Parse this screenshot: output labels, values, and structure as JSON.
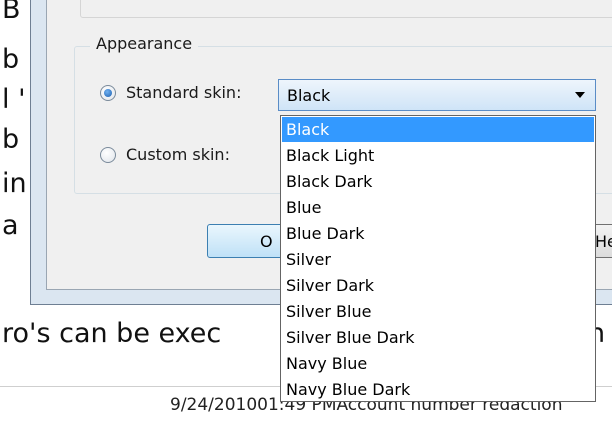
{
  "background": {
    "frag1": "B",
    "frag2": "b",
    "frag3": "l '",
    "frag4": "b",
    "frag5": "in",
    "frag6": "a",
    "frag7": "ro's can be exec",
    "frag8": "h",
    "footer": "9/24/201001:49 PMAccount number redaction"
  },
  "dialog": {
    "appearance_group": "Appearance",
    "standard_skin_label": "Standard skin:",
    "custom_skin_label": "Custom skin:",
    "skin_combo_value": "Black",
    "skin_options": [
      "Black",
      "Black Light",
      "Black Dark",
      "Blue",
      "Blue Dark",
      "Silver",
      "Silver Dark",
      "Silver Blue",
      "Silver Blue Dark",
      "Navy Blue",
      "Navy Blue Dark"
    ],
    "selected_skin_index": 0,
    "ok_button_partial": "O",
    "help_button_partial": "He"
  },
  "colors": {
    "selection": "#3399ff",
    "combo_border": "#5a8cc6"
  }
}
